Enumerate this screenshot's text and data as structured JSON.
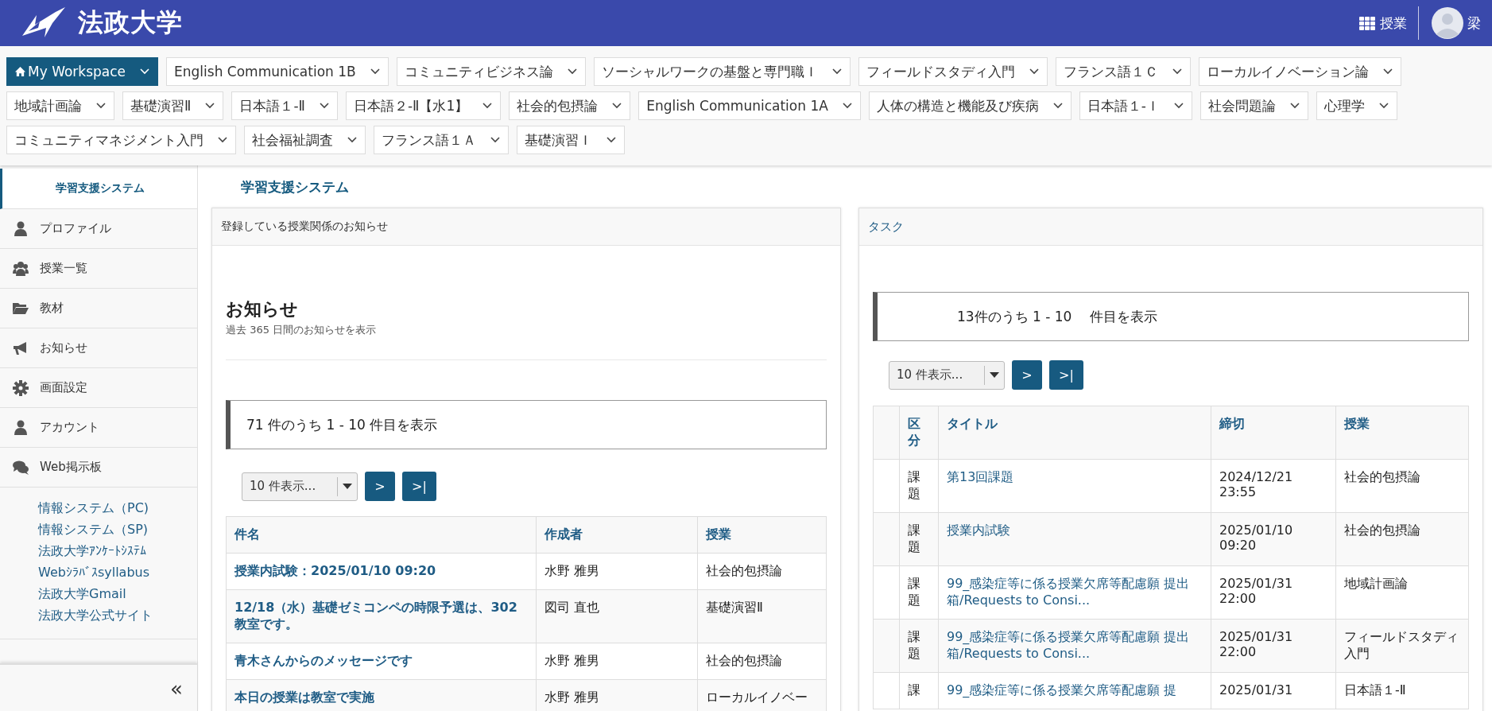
{
  "header": {
    "logo_text": "法政大学",
    "apps_label": "授業",
    "user_name": "梁"
  },
  "site_tabs": [
    {
      "label": "My Workspace",
      "selected": true,
      "kind": "home"
    },
    {
      "label": "English Communication 1B",
      "selected": false,
      "kind": "site"
    },
    {
      "label": "コミュニティビジネス論",
      "selected": false,
      "kind": "site"
    },
    {
      "label": "ソーシャルワークの基盤と専門職Ｉ",
      "selected": false,
      "kind": "site"
    },
    {
      "label": "フィールドスタディ入門",
      "selected": false,
      "kind": "site"
    },
    {
      "label": "フランス語１Ｃ",
      "selected": false,
      "kind": "site"
    },
    {
      "label": "ローカルイノベーション論",
      "selected": false,
      "kind": "site"
    },
    {
      "label": "地域計画論",
      "selected": false,
      "kind": "site"
    },
    {
      "label": "基礎演習Ⅱ",
      "selected": false,
      "kind": "site"
    },
    {
      "label": "日本語１-Ⅱ",
      "selected": false,
      "kind": "site"
    },
    {
      "label": "日本語２-Ⅱ【水1】",
      "selected": false,
      "kind": "site"
    },
    {
      "label": "社会的包摂論",
      "selected": false,
      "kind": "site"
    },
    {
      "label": "English Communication 1A",
      "selected": false,
      "kind": "site"
    },
    {
      "label": "人体の構造と機能及び疾病",
      "selected": false,
      "kind": "site"
    },
    {
      "label": "日本語１-Ｉ",
      "selected": false,
      "kind": "site"
    },
    {
      "label": "社会問題論",
      "selected": false,
      "kind": "site"
    },
    {
      "label": "心理学",
      "selected": false,
      "kind": "site"
    },
    {
      "label": "コミュニティマネジメント入門",
      "selected": false,
      "kind": "site"
    },
    {
      "label": "社会福祉調査",
      "selected": false,
      "kind": "site"
    },
    {
      "label": "フランス語１Ａ",
      "selected": false,
      "kind": "site"
    },
    {
      "label": "基礎演習Ｉ",
      "selected": false,
      "kind": "site"
    }
  ],
  "sidebar": {
    "title": "学習支援システム",
    "items": [
      {
        "label": "プロファイル"
      },
      {
        "label": "授業一覧"
      },
      {
        "label": "教材"
      },
      {
        "label": "お知らせ"
      },
      {
        "label": "画面設定"
      },
      {
        "label": "アカウント"
      },
      {
        "label": "Web掲示板"
      }
    ],
    "links": [
      "情報システム（PC)",
      "情報システム（SP)",
      "法政大学ｱﾝｹｰﾄｼｽﾃﾑ",
      "Webｼﾗﾊﾞｽsyllabus",
      "法政大学Gmail",
      "法政大学公式サイト"
    ],
    "collapse": "«"
  },
  "page_title": "学習支援システム",
  "announcements": {
    "header": "登録している授業関係のお知らせ",
    "title": "お知らせ",
    "subtitle": "過去 365 日間のお知らせを表示",
    "pager": {
      "summary": "71 件のうち 1 - 10 件目を表示",
      "page_size": "10 件表示...",
      "next": ">",
      "last": ">|"
    },
    "columns": [
      "件名",
      "作成者",
      "授業"
    ],
    "rows": [
      {
        "subject": "授業内試験：2025/01/10 09:20",
        "author": "水野 雅男",
        "course": "社会的包摂論"
      },
      {
        "subject": "12/18（水）基礎ゼミコンペの時限予選は、302教室です。",
        "author": "図司 直也",
        "course": "基礎演習Ⅱ"
      },
      {
        "subject": "青木さんからのメッセージです",
        "author": "水野 雅男",
        "course": "社会的包摂論"
      },
      {
        "subject": "本日の授業は教室で実施",
        "author": "水野 雅男",
        "course": "ローカルイノベー"
      }
    ]
  },
  "tasks": {
    "header": "タスク",
    "pager": {
      "summary": "13件のうち 1 - 10　 件目を表示",
      "page_size": "10 件表示...",
      "next": ">",
      "last": ">|"
    },
    "columns": [
      "区分",
      "タイトル",
      "締切",
      "授業"
    ],
    "rows": [
      {
        "type": "課題",
        "title": "第13回課題",
        "due": "2024/12/21 23:55",
        "course": "社会的包摂論"
      },
      {
        "type": "課題",
        "title": "授業内試験",
        "due": "2025/01/10 09:20",
        "course": "社会的包摂論"
      },
      {
        "type": "課題",
        "title": "99_感染症等に係る授業欠席等配慮願 提出箱/Requests to Consi...",
        "due": "2025/01/31 22:00",
        "course": "地域計画論"
      },
      {
        "type": "課題",
        "title": "99_感染症等に係る授業欠席等配慮願 提出箱/Requests to Consi...",
        "due": "2025/01/31 22:00",
        "course": "フィールドスタディ入門"
      },
      {
        "type": "課",
        "title": "99_感染症等に係る授業欠席等配慮願 提",
        "due": "2025/01/31",
        "course": "日本語１-Ⅱ"
      }
    ]
  }
}
